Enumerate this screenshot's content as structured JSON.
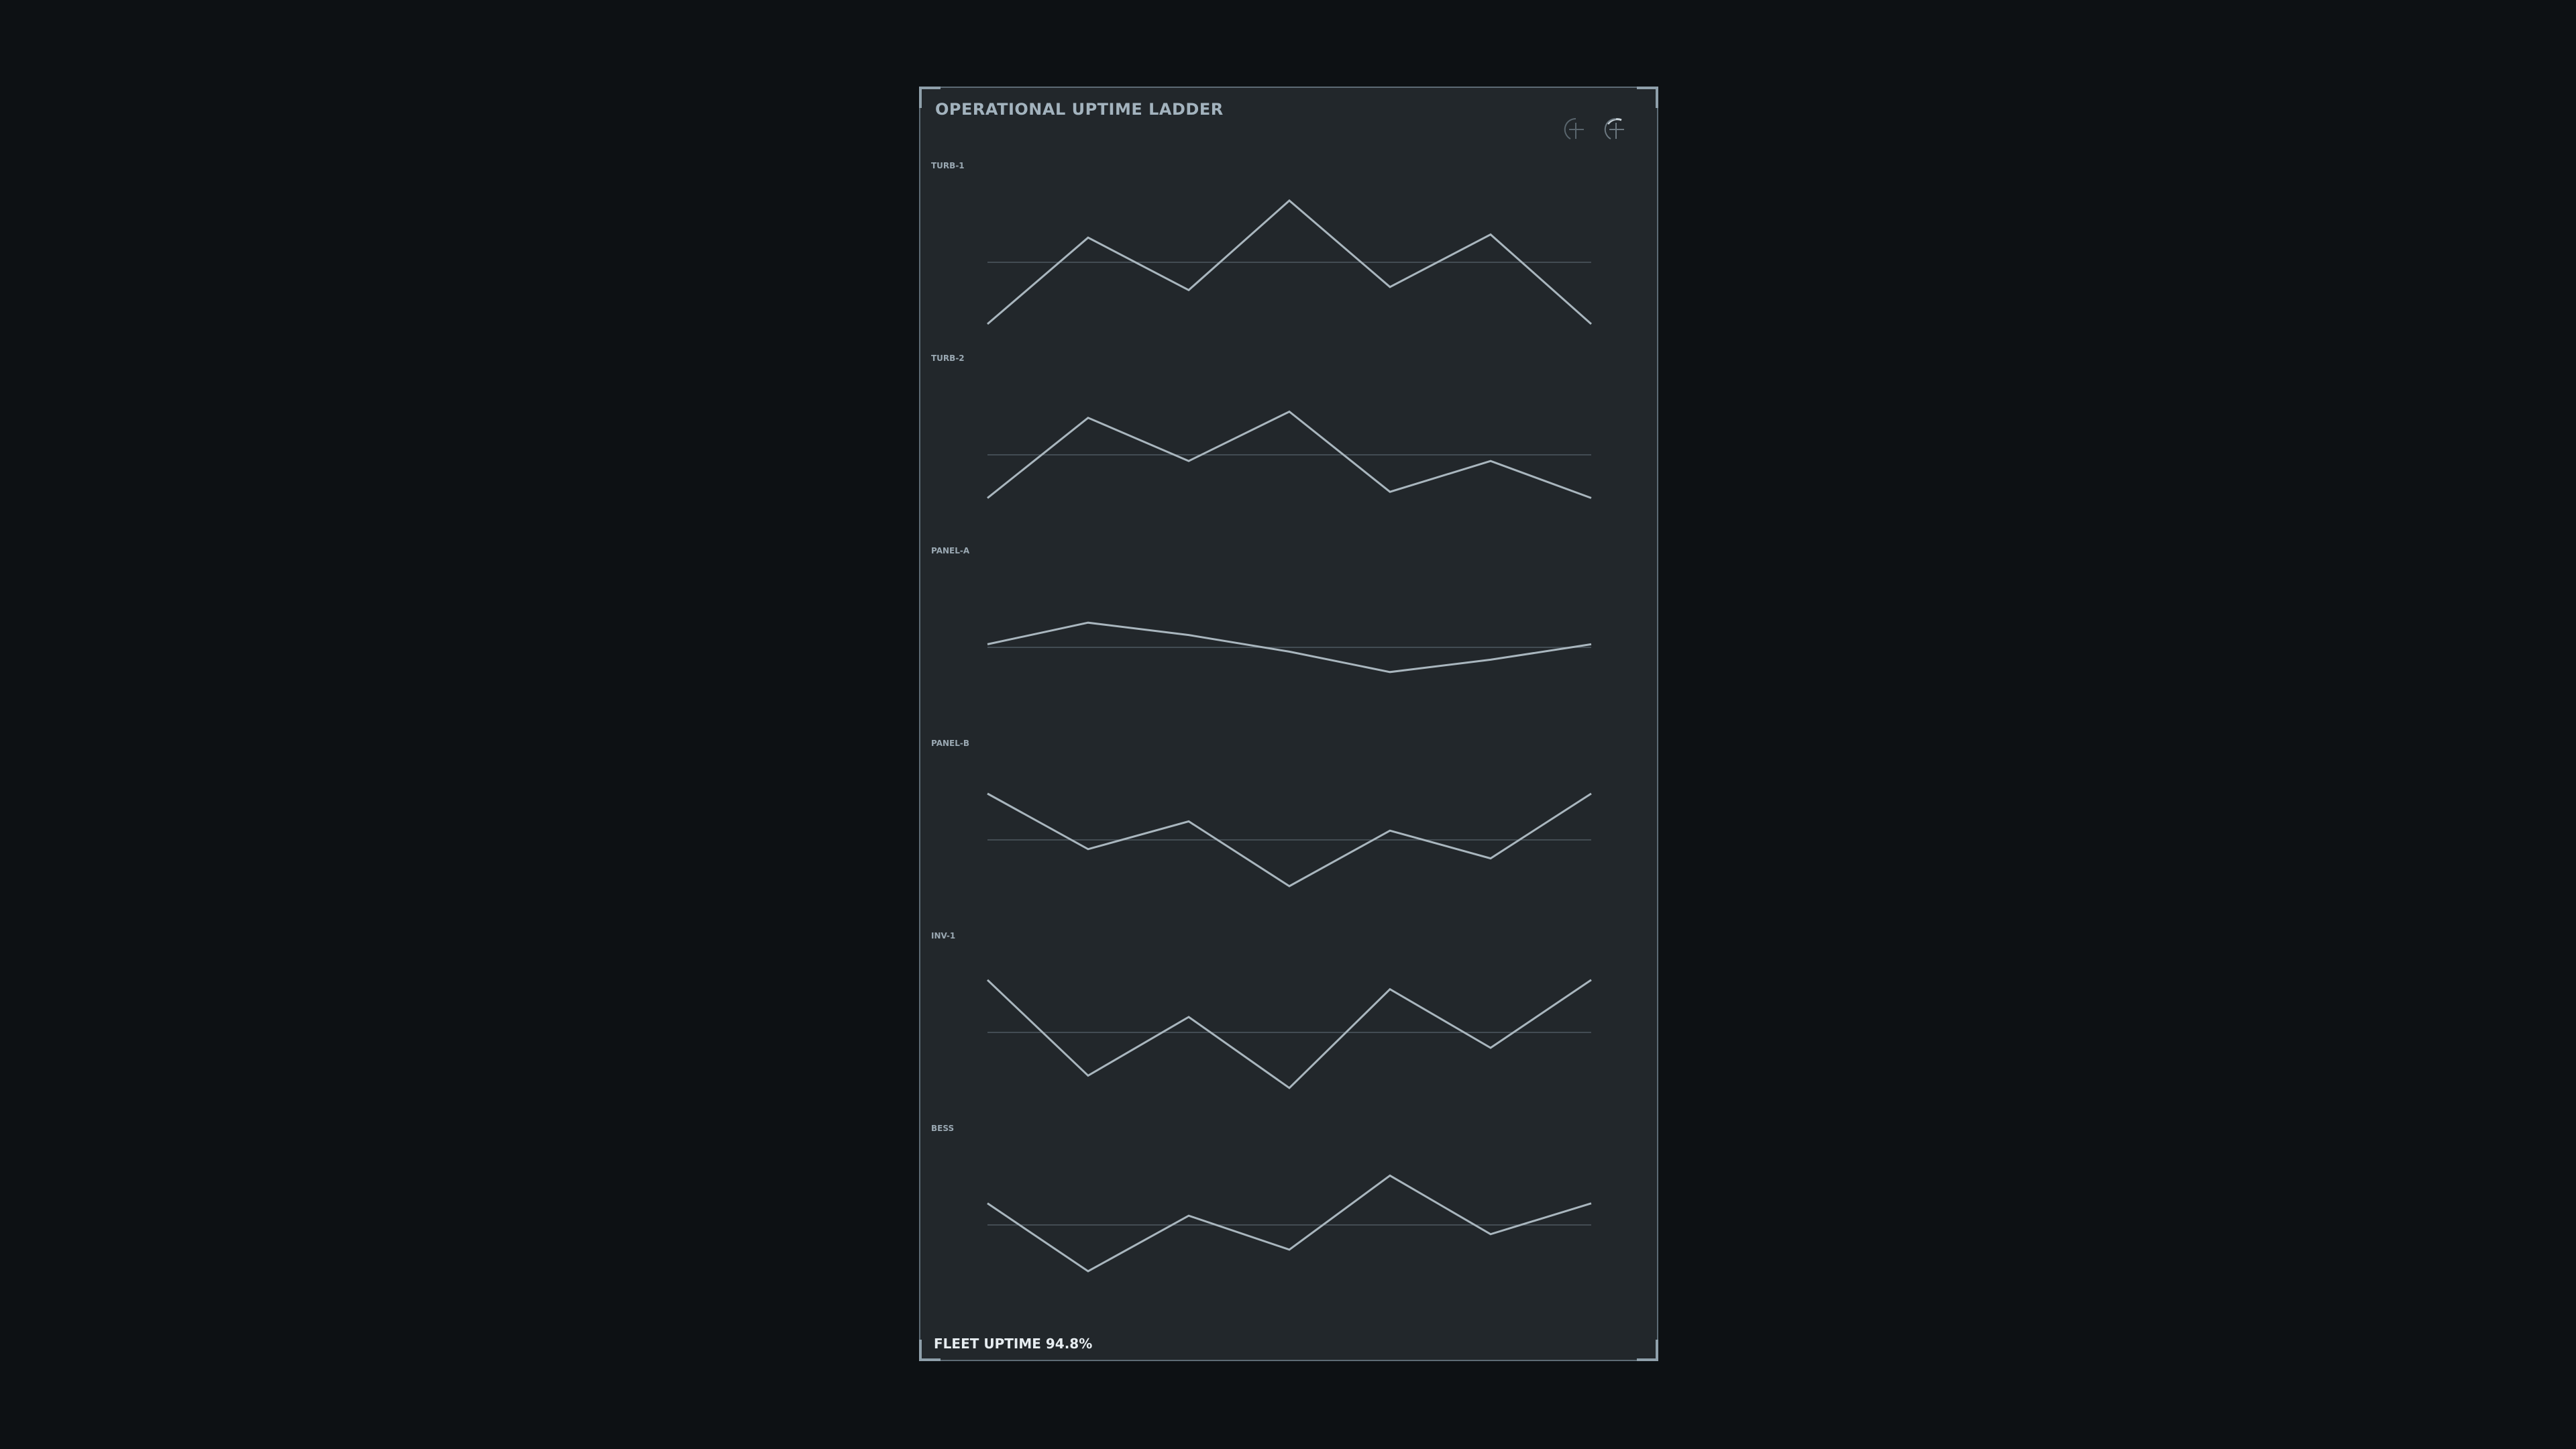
{
  "title": "OPERATIONAL UPTIME LADDER",
  "footer": {
    "label": "FLEET UPTIME",
    "value": "94.8%"
  },
  "toolbar": {
    "icons": [
      "zoom-icon",
      "reset-zoom-icon"
    ]
  },
  "colors": {
    "background": "#0d1114",
    "panel": "#22272b",
    "line": "#a9b6be",
    "baseline": "#4e5961",
    "title": "#a3b3be"
  },
  "chart_data": {
    "type": "line",
    "layout": "small-multiples",
    "title": "OPERATIONAL UPTIME LADDER",
    "x": [
      1,
      2,
      3,
      4,
      5,
      6,
      7
    ],
    "grid": false,
    "legend": "none",
    "axis_labels_shown": false,
    "series": [
      {
        "name": "TURB-1",
        "values": [
          -1.0,
          0.4,
          -0.45,
          1.0,
          -0.4,
          0.45,
          -1.0
        ],
        "baseline": 0
      },
      {
        "name": "TURB-2",
        "values": [
          -0.7,
          0.6,
          -0.1,
          0.7,
          -0.6,
          -0.1,
          -0.7
        ],
        "baseline": 0
      },
      {
        "name": "PANEL-A",
        "values": [
          0.05,
          0.4,
          0.2,
          -0.07,
          -0.4,
          -0.2,
          0.05
        ],
        "baseline": 0
      },
      {
        "name": "PANEL-B",
        "values": [
          0.75,
          -0.15,
          0.3,
          -0.75,
          0.15,
          -0.3,
          0.75
        ],
        "baseline": 0
      },
      {
        "name": "INV-1",
        "values": [
          0.85,
          -0.7,
          0.25,
          -0.9,
          0.7,
          -0.25,
          0.85
        ],
        "baseline": 0
      },
      {
        "name": "BESS",
        "values": [
          0.35,
          -0.75,
          0.15,
          -0.4,
          0.8,
          -0.15,
          0.35
        ],
        "baseline": 0
      }
    ]
  }
}
